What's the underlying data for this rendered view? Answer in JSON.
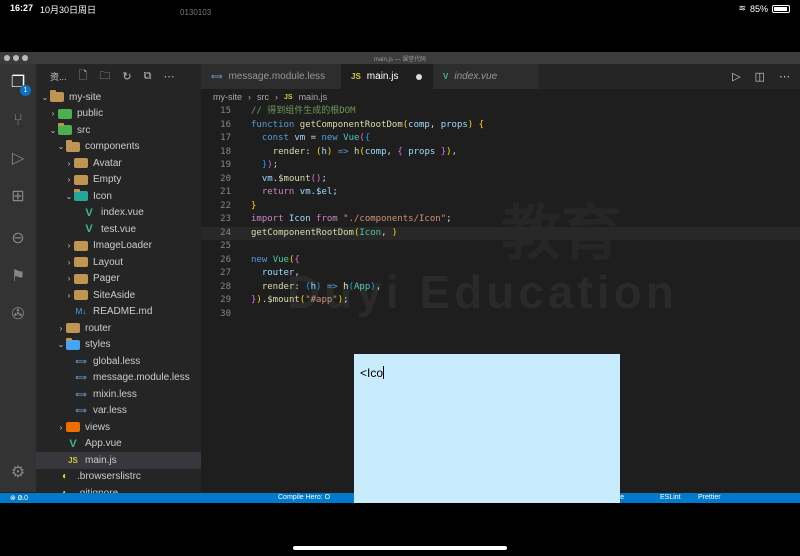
{
  "status_bar": {
    "time": "16:27",
    "date": "10月30日周日",
    "camera_label": "0130103",
    "battery": "85%"
  },
  "window": {
    "title": "main.js — 课堂代码"
  },
  "activity_bar": {
    "explorer_badge": "1"
  },
  "sidebar": {
    "header": "资...",
    "tree": [
      {
        "label": "my-site",
        "level": 1,
        "kind": "folder-open",
        "color": "folder"
      },
      {
        "label": "public",
        "level": 2,
        "kind": "folder",
        "color": "green"
      },
      {
        "label": "src",
        "level": 2,
        "kind": "folder-open",
        "color": "green"
      },
      {
        "label": "components",
        "level": 3,
        "kind": "folder-open",
        "color": "folder"
      },
      {
        "label": "Avatar",
        "level": 4,
        "kind": "folder",
        "color": "folder"
      },
      {
        "label": "Empty",
        "level": 4,
        "kind": "folder",
        "color": "folder"
      },
      {
        "label": "Icon",
        "level": 4,
        "kind": "folder-open",
        "color": "teal"
      },
      {
        "label": "index.vue",
        "level": 5,
        "kind": "vue"
      },
      {
        "label": "test.vue",
        "level": 5,
        "kind": "vue"
      },
      {
        "label": "ImageLoader",
        "level": 4,
        "kind": "folder",
        "color": "folder"
      },
      {
        "label": "Layout",
        "level": 4,
        "kind": "folder",
        "color": "folder"
      },
      {
        "label": "Pager",
        "level": 4,
        "kind": "folder",
        "color": "folder"
      },
      {
        "label": "SiteAside",
        "level": 4,
        "kind": "folder",
        "color": "folder"
      },
      {
        "label": "README.md",
        "level": 4,
        "kind": "md"
      },
      {
        "label": "router",
        "level": 3,
        "kind": "folder",
        "color": "folder"
      },
      {
        "label": "styles",
        "level": 3,
        "kind": "folder-open",
        "color": "blue"
      },
      {
        "label": "global.less",
        "level": 4,
        "kind": "less"
      },
      {
        "label": "message.module.less",
        "level": 4,
        "kind": "less"
      },
      {
        "label": "mixin.less",
        "level": 4,
        "kind": "less"
      },
      {
        "label": "var.less",
        "level": 4,
        "kind": "less"
      },
      {
        "label": "views",
        "level": 3,
        "kind": "folder",
        "color": "orange"
      },
      {
        "label": "App.vue",
        "level": 3,
        "kind": "vue"
      },
      {
        "label": "main.js",
        "level": 3,
        "kind": "js",
        "selected": true
      },
      {
        "label": ".browserslistrc",
        "level": 2,
        "kind": "rc"
      },
      {
        "label": ".gitignore",
        "level": 2,
        "kind": "rc"
      }
    ]
  },
  "tabs": [
    {
      "label": "message.module.less",
      "icon": "less",
      "active": false
    },
    {
      "label": "main.js",
      "icon": "JS",
      "active": true,
      "modified": true
    },
    {
      "label": "index.vue",
      "icon": "vue",
      "active": false
    }
  ],
  "breadcrumb": [
    "my-site",
    "src",
    "main.js"
  ],
  "editor": {
    "lines": [
      {
        "n": "15",
        "html": "<span class='cm'>// 得到组件生成的根DOM</span>"
      },
      {
        "n": "16",
        "html": "<span class='kwb'>function</span> <span class='fn'>getComponentRootDom</span><span class='brk'>(</span><span class='var'>comp</span>, <span class='var'>props</span><span class='brk'>)</span> <span class='brk'>{</span>"
      },
      {
        "n": "17",
        "html": "  <span class='kwb'>const</span> <span class='var'>vm</span> = <span class='kwb'>new</span> <span class='cls'>Vue</span><span class='brk2'>(</span><span class='brk3'>{</span>"
      },
      {
        "n": "18",
        "html": "    <span class='fn'>render</span>: <span class='brk'>(</span><span class='var'>h</span><span class='brk'>)</span> <span class='kwb'>=&gt;</span> <span class='fn'>h</span><span class='brk'>(</span><span class='var'>comp</span>, <span class='brk2'>{</span> <span class='var'>props</span> <span class='brk2'>}</span><span class='brk'>)</span>,"
      },
      {
        "n": "19",
        "html": "  <span class='brk3'>}</span><span class='brk2'>)</span>;"
      },
      {
        "n": "20",
        "html": "  <span class='var'>vm</span>.<span class='fn'>$mount</span><span class='brk2'>()</span>;"
      },
      {
        "n": "21",
        "html": "  <span class='kw'>return</span> <span class='var'>vm</span>.<span class='var'>$el</span>;"
      },
      {
        "n": "22",
        "html": "<span class='brk'>}</span>"
      },
      {
        "n": "23",
        "html": "<span class='kw'>import</span> <span class='var'>Icon</span> <span class='kw'>from</span> <span class='str'>\"./components/Icon\"</span>;"
      },
      {
        "n": "24",
        "html": "<span class='fn'>getComponentRootDom</span><span class='brk'>(</span><span class='cls'>Icon</span>, <span class='brk'>)</span>",
        "current": true
      },
      {
        "n": "25",
        "html": ""
      },
      {
        "n": "26",
        "html": "<span class='kwb'>new</span> <span class='cls'>Vue</span><span class='brk'>(</span><span class='brk2'>{</span>"
      },
      {
        "n": "27",
        "html": "  <span class='var'>router</span>,"
      },
      {
        "n": "28",
        "html": "  <span class='fn'>render</span>: <span class='brk3'>(</span><span class='var'>h</span><span class='brk3'>)</span> <span class='kwb'>=&gt;</span> <span class='fn'>h</span><span class='brk3'>(</span><span class='cls'>App</span><span class='brk3'>)</span>,"
      },
      {
        "n": "29",
        "html": "<span class='brk2'>}</span><span class='brk'>)</span>.<span class='fn'>$mount</span><span class='brk'>(</span><span class='str'>\"#app\"</span><span class='brk'>)</span>;"
      },
      {
        "n": "30",
        "html": ""
      }
    ],
    "watermark_cn": "教育",
    "watermark_en": "Duyi Education"
  },
  "status": {
    "errors": "0",
    "warnings": "0",
    "compile": "Compile Hero: O",
    "live": "Go Live",
    "eslint": "ESLint",
    "prettier": "Prettier"
  },
  "overlay": {
    "text": "<Ico"
  }
}
